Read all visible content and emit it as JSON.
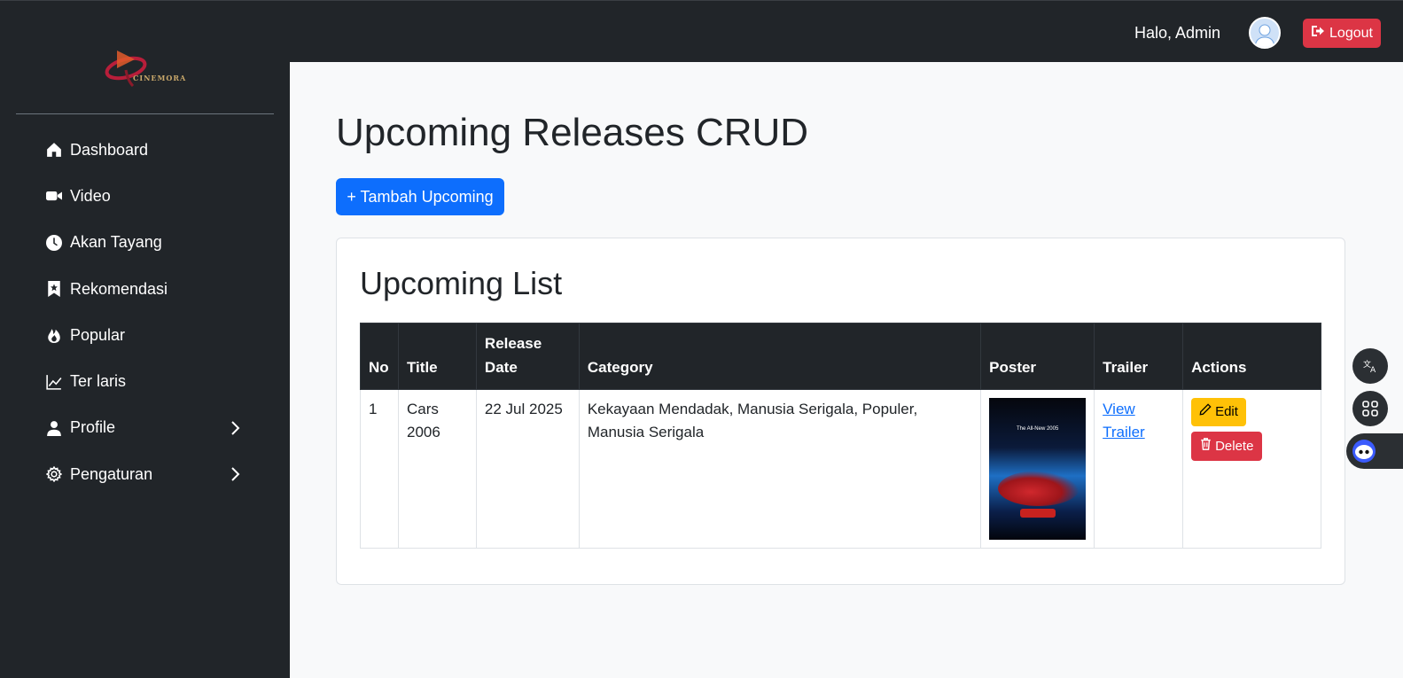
{
  "brand": {
    "name": "CINEMORA"
  },
  "sidebar": {
    "items": [
      {
        "label": "Dashboard",
        "icon": "home-icon"
      },
      {
        "label": "Video",
        "icon": "video-icon"
      },
      {
        "label": "Akan Tayang",
        "icon": "clock-icon"
      },
      {
        "label": "Rekomendasi",
        "icon": "bookmark-icon"
      },
      {
        "label": "Popular",
        "icon": "fire-icon"
      },
      {
        "label": "Ter laris",
        "icon": "chart-line-icon"
      },
      {
        "label": "Profile",
        "icon": "user-icon",
        "has_submenu": true
      },
      {
        "label": "Pengaturan",
        "icon": "gear-icon",
        "has_submenu": true
      }
    ]
  },
  "topbar": {
    "greeting": "Halo, Admin",
    "logout_label": "Logout"
  },
  "main": {
    "title": "Upcoming Releases CRUD",
    "add_button_label": "+ Tambah Upcoming",
    "card_title": "Upcoming List",
    "table": {
      "headers": [
        "No",
        "Title",
        "Release Date",
        "Category",
        "Poster",
        "Trailer",
        "Actions"
      ],
      "rows": [
        {
          "no": "1",
          "title": "Cars 2006",
          "release_date": "22 Jul 2025",
          "category": "Kekayaan Mendadak, Manusia Serigala, Populer, Manusia Serigala",
          "poster_caption": "The All-New 2005",
          "trailer_label": "View Trailer",
          "edit_label": "Edit",
          "delete_label": "Delete"
        }
      ]
    }
  },
  "colors": {
    "sidebar_bg": "#212529",
    "primary": "#0d6efd",
    "danger": "#dc3545",
    "warning": "#ffc107"
  }
}
